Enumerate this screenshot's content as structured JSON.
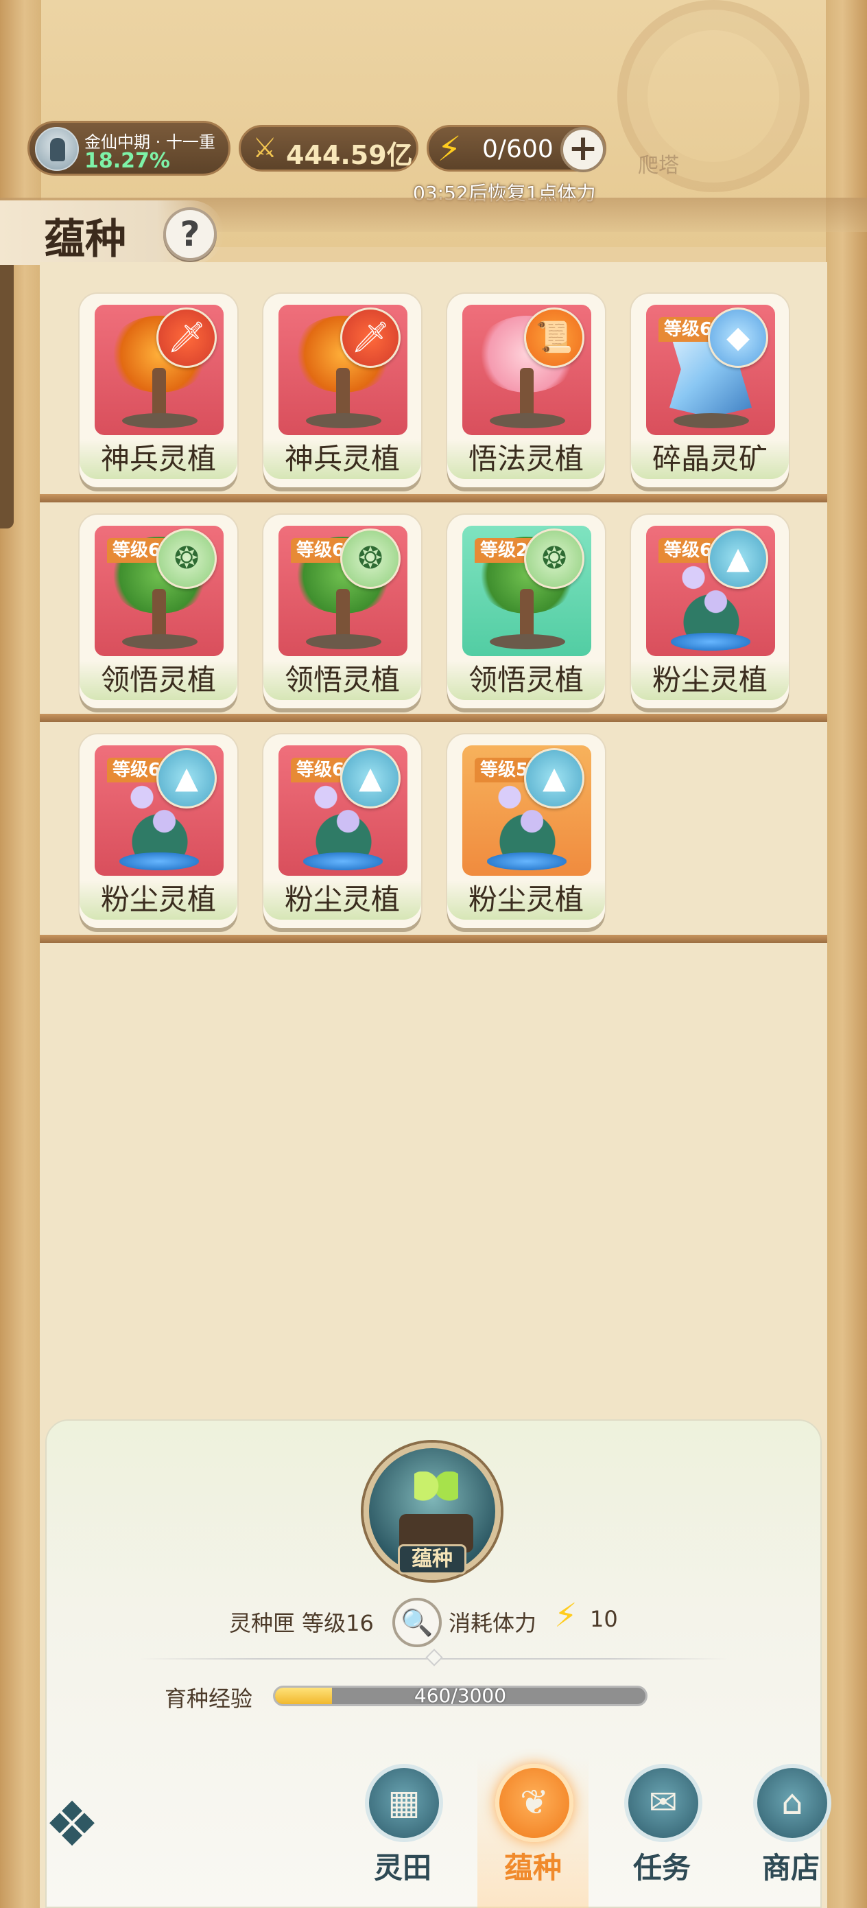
{
  "status": {
    "realm_name": "金仙中期 · 十一重",
    "realm_progress": "18.27%",
    "power": "444.59亿",
    "stamina": "0/600",
    "recover_text": "03:52后恢复1点体力",
    "climb_label": "爬塔"
  },
  "page": {
    "title": "蕴种",
    "help": "?"
  },
  "cards": [
    {
      "label": "神兵灵植",
      "level": "",
      "art": "maple",
      "type": "weapon"
    },
    {
      "label": "神兵灵植",
      "level": "",
      "art": "maple",
      "type": "weapon"
    },
    {
      "label": "悟法灵植",
      "level": "",
      "art": "blossom",
      "type": "scroll"
    },
    {
      "label": "碎晶灵矿",
      "level": "等级6",
      "art": "crystal",
      "type": "crystal"
    },
    {
      "label": "领悟灵植",
      "level": "等级6",
      "art": "golden-tree",
      "type": "gourd"
    },
    {
      "label": "领悟灵植",
      "level": "等级6",
      "art": "golden-tree",
      "type": "gourd"
    },
    {
      "label": "领悟灵植",
      "level": "等级2",
      "art": "green-tree",
      "type": "gourd"
    },
    {
      "label": "粉尘灵植",
      "level": "等级6",
      "art": "lotus",
      "type": "dust"
    },
    {
      "label": "粉尘灵植",
      "level": "等级6",
      "art": "lotus",
      "type": "dust"
    },
    {
      "label": "粉尘灵植",
      "level": "等级6",
      "art": "lotus",
      "type": "dust"
    },
    {
      "label": "粉尘灵植",
      "level": "等级5",
      "art": "lotus-orange",
      "type": "dust"
    }
  ],
  "seed_box": {
    "emblem_label": "蕴种",
    "name_level": "灵种匣 等级16",
    "cost_label": "消耗体力",
    "cost_value": "10",
    "exp_label": "育种经验",
    "exp_text": "460/3000",
    "exp_progress": 0.153
  },
  "nav": [
    {
      "label": "灵田",
      "icon": "field-icon",
      "active": false
    },
    {
      "label": "蕴种",
      "icon": "sprout-icon",
      "active": true
    },
    {
      "label": "任务",
      "icon": "scroll-icon",
      "active": false
    },
    {
      "label": "商店",
      "icon": "shop-icon",
      "active": false
    }
  ],
  "colors": {
    "accent": "#f08a2c",
    "nav_text": "#2e4a55",
    "progress_green": "#7ef2a8",
    "stamina_yellow": "#ffcc1f"
  }
}
